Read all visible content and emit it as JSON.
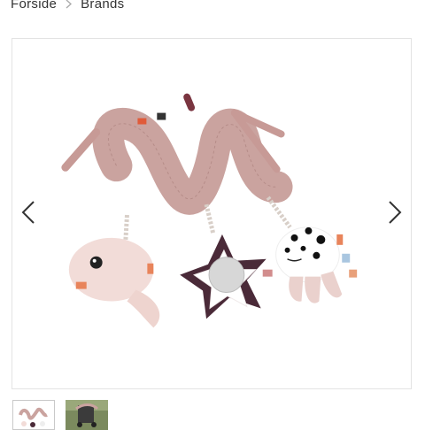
{
  "breadcrumb": {
    "items": [
      "Forside",
      "Brands"
    ]
  },
  "gallery": {
    "current_image": "spiral-activity-toy",
    "prev_icon": "chevron-left-icon",
    "next_icon": "chevron-right-icon",
    "thumbnails": [
      {
        "name": "spiral-activity-toy",
        "active": true
      },
      {
        "name": "stroller-with-toy",
        "active": false
      }
    ]
  },
  "colors": {
    "toy_pink": "#caa39f",
    "toy_light": "#f2dcd8",
    "star_plum": "#4a2a38",
    "border": "#e3e3e3"
  }
}
